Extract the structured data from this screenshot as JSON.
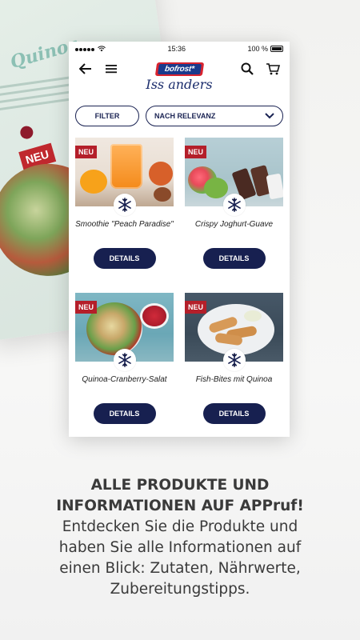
{
  "background": {
    "magazine_title": "Quinoa",
    "badge": "NEU"
  },
  "status_bar": {
    "time": "15:36",
    "battery": "100 %"
  },
  "header": {
    "logo_text": "bofrost*",
    "subtitle": "Iss anders"
  },
  "controls": {
    "filter_label": "FILTER",
    "sort_label": "NACH RELEVANZ"
  },
  "products": [
    {
      "name": "Smoothie \"Peach Paradise\"",
      "badge": "NEU",
      "details_label": "DETAILS"
    },
    {
      "name": "Crispy Joghurt-Guave",
      "badge": "NEU",
      "details_label": "DETAILS"
    },
    {
      "name": "Quinoa-Cranberry-Salat",
      "badge": "NEU",
      "details_label": "DETAILS"
    },
    {
      "name": "Fish-Bites mit Quinoa",
      "badge": "NEU",
      "details_label": "DETAILS"
    }
  ],
  "promo": {
    "title_line1": "ALLE PRODUKTE UND",
    "title_line2": "INFORMATIONEN AUF APPruf!",
    "body_line1": "Entdecken Sie die Produkte und",
    "body_line2": "haben Sie alle Informationen auf",
    "body_line3": "einen Blick: Zutaten, Nährwerte,",
    "body_line4": "Zubereitungstipps."
  },
  "colors": {
    "brand_red": "#d9232e",
    "brand_blue": "#1a3a8c",
    "button_navy": "#172050",
    "badge_red": "#b41f2a"
  }
}
